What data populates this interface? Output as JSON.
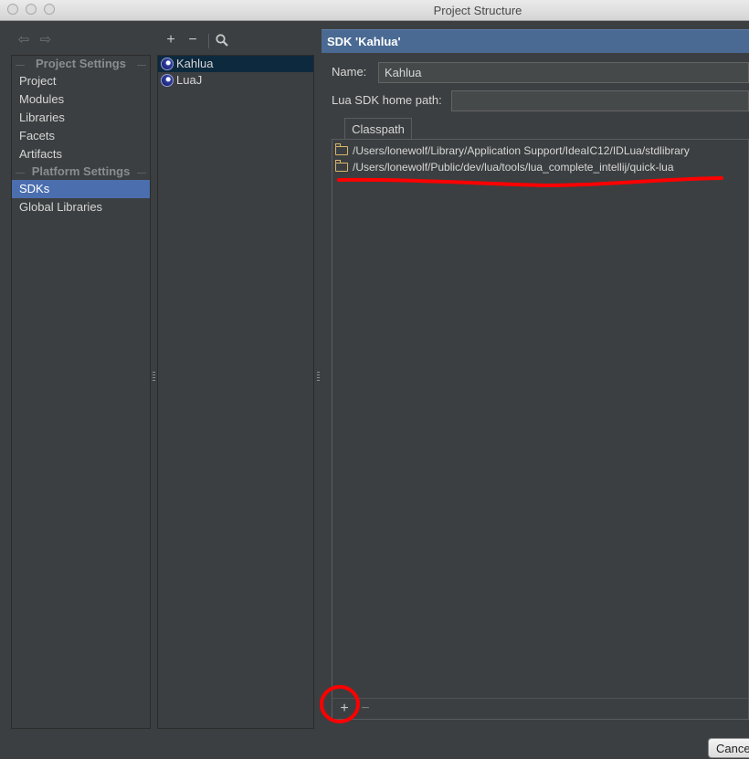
{
  "window": {
    "title": "Project Structure"
  },
  "nav": {
    "back_icon": "arrow-left-icon",
    "forward_icon": "arrow-right-icon",
    "project_settings_header": "Project Settings",
    "platform_settings_header": "Platform Settings",
    "project_items": [
      {
        "label": "Project"
      },
      {
        "label": "Modules"
      },
      {
        "label": "Libraries"
      },
      {
        "label": "Facets"
      },
      {
        "label": "Artifacts"
      }
    ],
    "platform_items": [
      {
        "label": "SDKs",
        "selected": true
      },
      {
        "label": "Global Libraries"
      }
    ]
  },
  "sdk_toolbar": {
    "add": "+",
    "remove": "−",
    "search_icon": "magnifier-icon"
  },
  "sdks": [
    {
      "label": "Kahlua",
      "selected": true
    },
    {
      "label": "LuaJ"
    }
  ],
  "detail": {
    "header": "SDK 'Kahlua'",
    "name_label": "Name:",
    "name_value": "Kahlua",
    "home_label": "Lua SDK home path:",
    "home_value": "",
    "tab": "Classpath",
    "classpath": [
      {
        "path": "/Users/lonewolf/Library/Application Support/IdeaIC12/IDLua/stdlibrary"
      },
      {
        "path": "/Users/lonewolf/Public/dev/lua/tools/lua_complete_intellij/quick-lua"
      }
    ],
    "add": "+",
    "remove": "−"
  },
  "footer": {
    "cancel_label": "Cance"
  },
  "colors": {
    "accent": "#4b6eaf",
    "header": "#4a6a93",
    "annotation": "#ff0000"
  }
}
